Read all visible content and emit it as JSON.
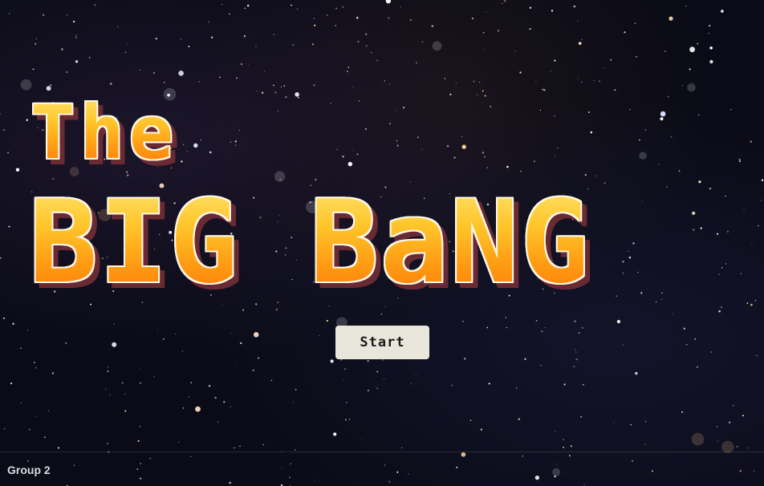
{
  "game": {
    "title_line1": "The",
    "title_line2": "BIG BaNG",
    "start_label": "Start"
  },
  "footer": {
    "group_label": "Group 2"
  },
  "colors": {
    "background": "#0a0b16",
    "title_fill_top": "#ffe26a",
    "title_fill_bottom": "#ff7a0a",
    "title_outline": "#fff8e8",
    "title_shadow": "#6a2a34",
    "button_bg": "#e9e6dc"
  }
}
